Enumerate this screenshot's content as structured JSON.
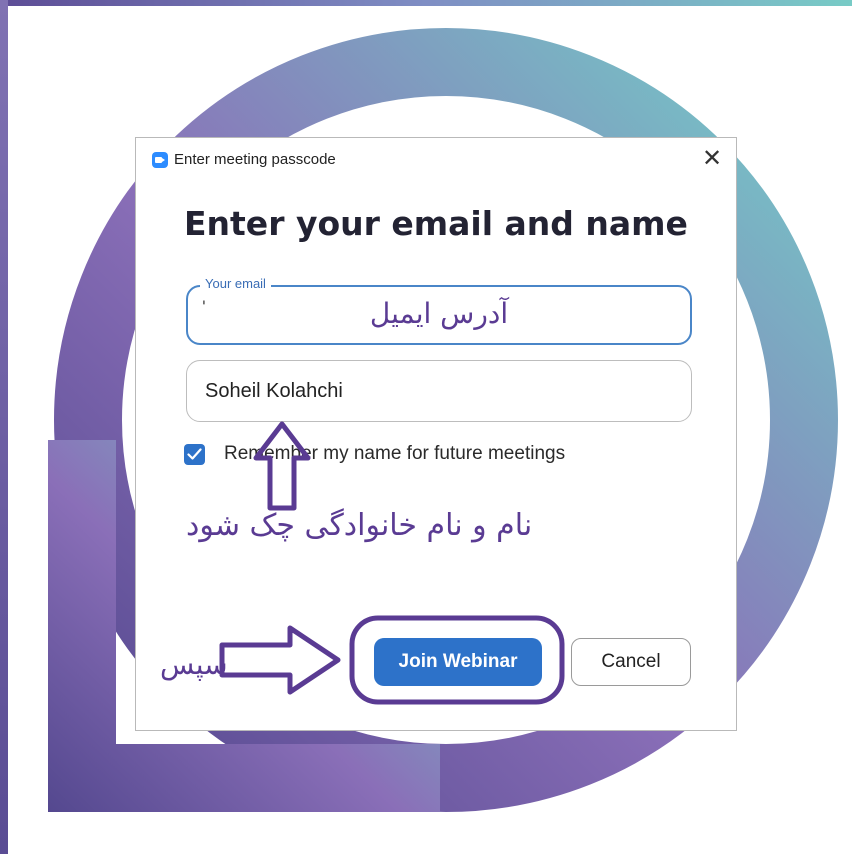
{
  "colors": {
    "frame_left": "#5d4d96",
    "frame_right": "#78cbc6",
    "annotation": "#5a3b93",
    "accent": "#2d72c9"
  },
  "dialog": {
    "window_title": "Enter meeting passcode",
    "close_glyph": "✕",
    "heading": "Enter your email and name",
    "email": {
      "legend": "Your email",
      "value": "'",
      "annotation": "آدرس ایمیل"
    },
    "name": {
      "value": "Soheil Kolahchi"
    },
    "remember": {
      "checked": true,
      "label": "Remember my name for future meetings"
    },
    "name_annotation": "نام و نام خانوادگی چک شود",
    "then_annotation": "سپس",
    "buttons": {
      "join": "Join Webinar",
      "cancel": "Cancel"
    }
  }
}
